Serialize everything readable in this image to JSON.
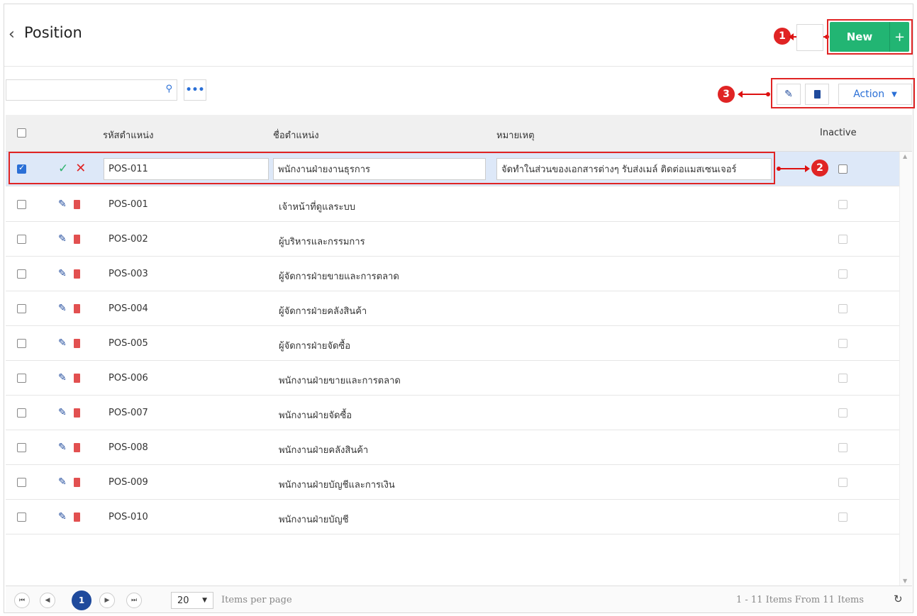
{
  "page": {
    "title": "Position",
    "back_icon": "chevron-left-icon"
  },
  "toolbar": {
    "new_label": "New",
    "new_plus": "+",
    "action_label": "Action"
  },
  "markers": {
    "m1": "1",
    "m2": "2",
    "m3": "3"
  },
  "search": {
    "placeholder": "",
    "more_label": "•••"
  },
  "columns": {
    "code": "รหัสตำแหน่ง",
    "name": "ชื่อตำแหน่ง",
    "note": "หมายเหตุ",
    "inactive": "Inactive"
  },
  "edit_row": {
    "code": "POS-011",
    "name": "พนักงานฝ่ายงานธุรการ",
    "note": "จัดทำในส่วนของเอกสารต่างๆ รับส่งเมล์ ติดต่อแมสเซนเจอร์"
  },
  "rows": [
    {
      "code": "POS-001",
      "name": "เจ้าหน้าที่ดูแลระบบ"
    },
    {
      "code": "POS-002",
      "name": "ผู้บริหารและกรรมการ"
    },
    {
      "code": "POS-003",
      "name": "ผู้จัดการฝ่ายขายและการตลาด"
    },
    {
      "code": "POS-004",
      "name": "ผู้จัดการฝ่ายคลังสินค้า"
    },
    {
      "code": "POS-005",
      "name": "ผู้จัดการฝ่ายจัดซื้อ"
    },
    {
      "code": "POS-006",
      "name": "พนักงานฝ่ายขายและการตลาด"
    },
    {
      "code": "POS-007",
      "name": "พนักงานฝ่ายจัดซื้อ"
    },
    {
      "code": "POS-008",
      "name": "พนักงานฝ่ายคลังสินค้า"
    },
    {
      "code": "POS-009",
      "name": "พนักงานฝ่ายบัญชีและการเงิน"
    },
    {
      "code": "POS-010",
      "name": "พนักงานฝ่ายบัญชี"
    }
  ],
  "pager": {
    "current": "1",
    "page_size": "20",
    "items_per_page": "Items per page",
    "info": "1 - 11 Items From 11 Items"
  },
  "colors": {
    "new_green": "#22b573",
    "marker_red": "#e02424",
    "accent_blue": "#1f4a9c",
    "trash_red": "#e25050"
  }
}
